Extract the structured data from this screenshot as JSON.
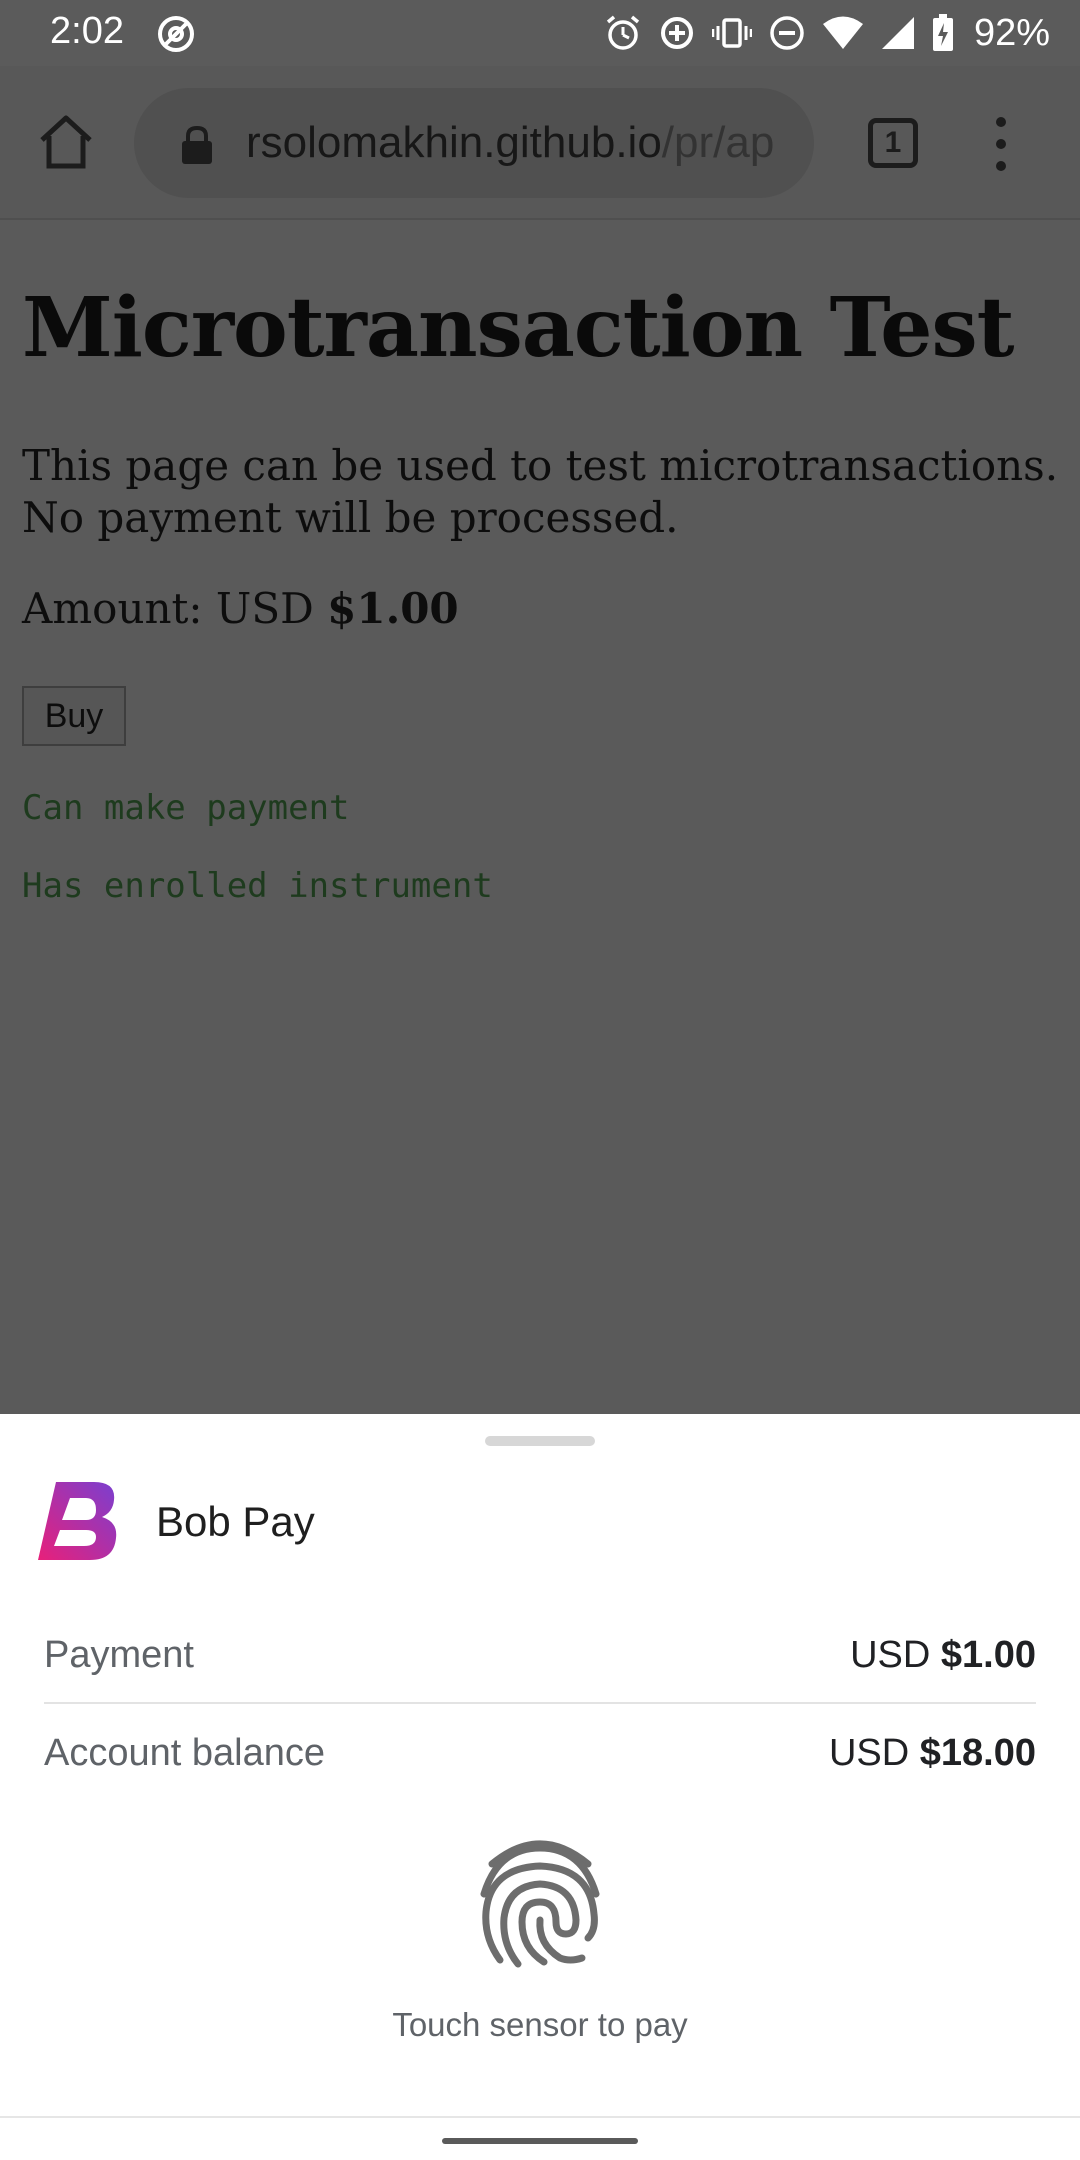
{
  "status_bar": {
    "time": "2:02",
    "battery": "92%"
  },
  "browser": {
    "url_host": "rsolomakhin.github.io",
    "url_path": "/pr/ap",
    "tab_count": "1"
  },
  "page": {
    "title": "Microtransaction Test",
    "description": "This page can be used to test microtransactions. No payment will be processed.",
    "amount_label": "Amount: USD ",
    "amount_value": "$1.00",
    "buy_label": "Buy",
    "status_messages": [
      "Can make payment",
      "Has enrolled instrument"
    ]
  },
  "payment_sheet": {
    "app_name": "Bob Pay",
    "rows": [
      {
        "label": "Payment",
        "currency": "USD",
        "amount": "$1.00"
      },
      {
        "label": "Account balance",
        "currency": "USD",
        "amount": "$18.00"
      }
    ],
    "prompt": "Touch sensor to pay"
  },
  "colors": {
    "scrim": "#5a5a5a",
    "logo_gradient_start": "#e8207a",
    "logo_gradient_end": "#7a3fd0",
    "status_message_green": "#1e3b1e"
  }
}
